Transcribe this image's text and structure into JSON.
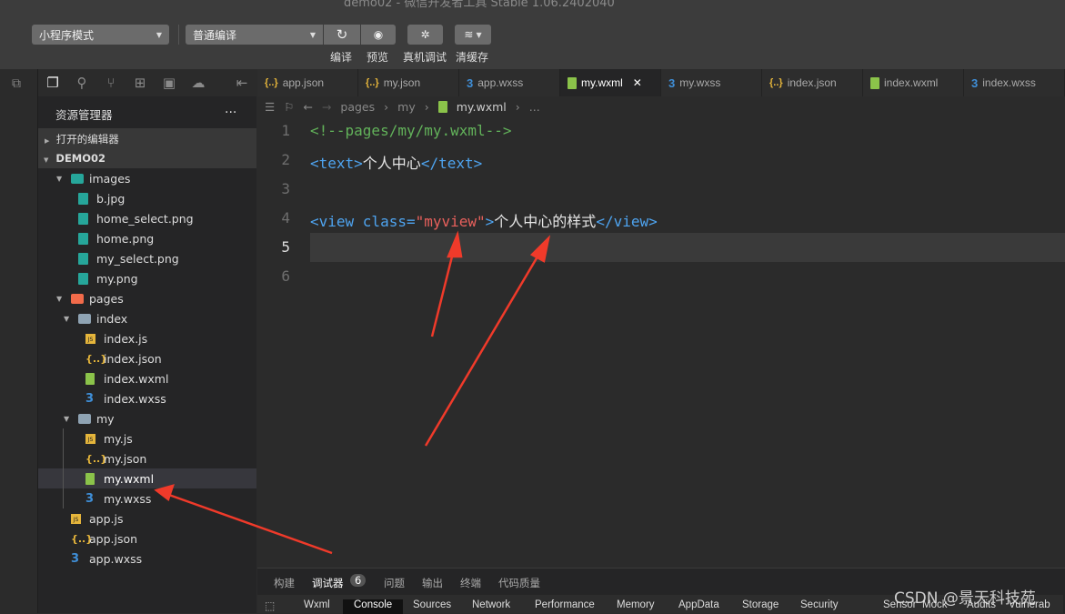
{
  "window": {
    "title": "demo02 - 微信开发者工具 Stable 1.06.2402040"
  },
  "toolbar": {
    "mode": "小程序模式",
    "compile_mode": "普通编译",
    "compile": "编译",
    "preview": "预览",
    "remote_debug": "真机调试",
    "clear_cache": "清缓存"
  },
  "sidebar": {
    "title": "资源管理器",
    "more": "...",
    "open_editors": "打开的编辑器",
    "project": "DEMO02"
  },
  "tree": [
    {
      "name": "images",
      "type": "folder-images",
      "children": [
        {
          "name": "b.jpg",
          "type": "img"
        },
        {
          "name": "home_select.png",
          "type": "img"
        },
        {
          "name": "home.png",
          "type": "img"
        },
        {
          "name": "my_select.png",
          "type": "img"
        },
        {
          "name": "my.png",
          "type": "img"
        }
      ]
    },
    {
      "name": "pages",
      "type": "folder-pages",
      "children": [
        {
          "name": "index",
          "type": "folder",
          "children": [
            {
              "name": "index.js",
              "type": "js"
            },
            {
              "name": "index.json",
              "type": "json"
            },
            {
              "name": "index.wxml",
              "type": "wxml"
            },
            {
              "name": "index.wxss",
              "type": "css"
            }
          ]
        },
        {
          "name": "my",
          "type": "folder",
          "children": [
            {
              "name": "my.js",
              "type": "js"
            },
            {
              "name": "my.json",
              "type": "json"
            },
            {
              "name": "my.wxml",
              "type": "wxml",
              "selected": true
            },
            {
              "name": "my.wxss",
              "type": "css"
            }
          ]
        }
      ]
    },
    {
      "name": "app.js",
      "type": "js"
    },
    {
      "name": "app.json",
      "type": "json"
    },
    {
      "name": "app.wxss",
      "type": "css"
    }
  ],
  "tabs": [
    {
      "label": "app.json",
      "type": "json"
    },
    {
      "label": "my.json",
      "type": "json"
    },
    {
      "label": "app.wxss",
      "type": "css"
    },
    {
      "label": "my.wxml",
      "type": "wxml",
      "active": true
    },
    {
      "label": "my.wxss",
      "type": "css"
    },
    {
      "label": "index.json",
      "type": "json"
    },
    {
      "label": "index.wxml",
      "type": "wxml"
    },
    {
      "label": "index.wxss",
      "type": "css"
    }
  ],
  "breadcrumb": [
    "pages",
    "my",
    "my.wxml",
    "..."
  ],
  "code": {
    "l1": "<!--pages/my/my.wxml-->",
    "l2a": "<text>",
    "l2b": "个人中心",
    "l2c": "</text>",
    "l4a": "<view class=",
    "l4b": "\"myview\"",
    "l4c": ">",
    "l4d": "个人中心的样式",
    "l4e": "</view>",
    "line_numbers": [
      "1",
      "2",
      "3",
      "4",
      "5",
      "6"
    ]
  },
  "bottom": {
    "tabs": [
      "构建",
      "调试器",
      "问题",
      "输出",
      "终端",
      "代码质量"
    ],
    "badge": "6",
    "devtools": [
      "Wxml",
      "Console",
      "Sources",
      "Network",
      "Performance",
      "Memory",
      "AppData",
      "Storage",
      "Security",
      "Sensor",
      "Mock",
      "Audits",
      "Vulnerab"
    ]
  },
  "watermark": "CSDN @景天科技苑",
  "colors": {
    "arrow": "#f03a2a",
    "comment": "#62b25a",
    "tag": "#4ea4f0",
    "string": "#e8605c"
  }
}
